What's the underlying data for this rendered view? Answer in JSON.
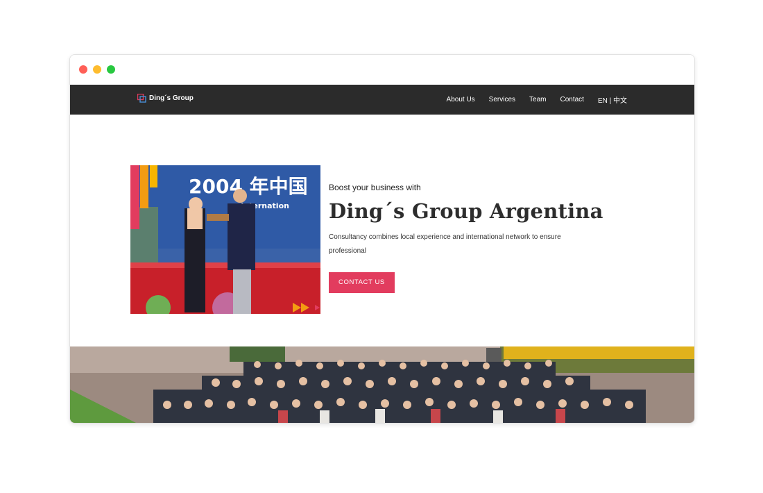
{
  "nav": {
    "brand": "Ding´s Group",
    "links": [
      "About Us",
      "Services",
      "Team",
      "Contact",
      "EN | 中文"
    ]
  },
  "hero": {
    "kicker": "Boost your business with",
    "headline": "Ding´s Group Argentina",
    "description": "Consultancy combines local experience and international network to ensure professional",
    "cta": "CONTACT US",
    "photo_sign_text": "2004 年中国",
    "photo_sign_subtext": "on Internation"
  },
  "colors": {
    "accent": "#e23c5e",
    "nav_bg": "#2b2b2b",
    "orange": "#f39c12"
  }
}
